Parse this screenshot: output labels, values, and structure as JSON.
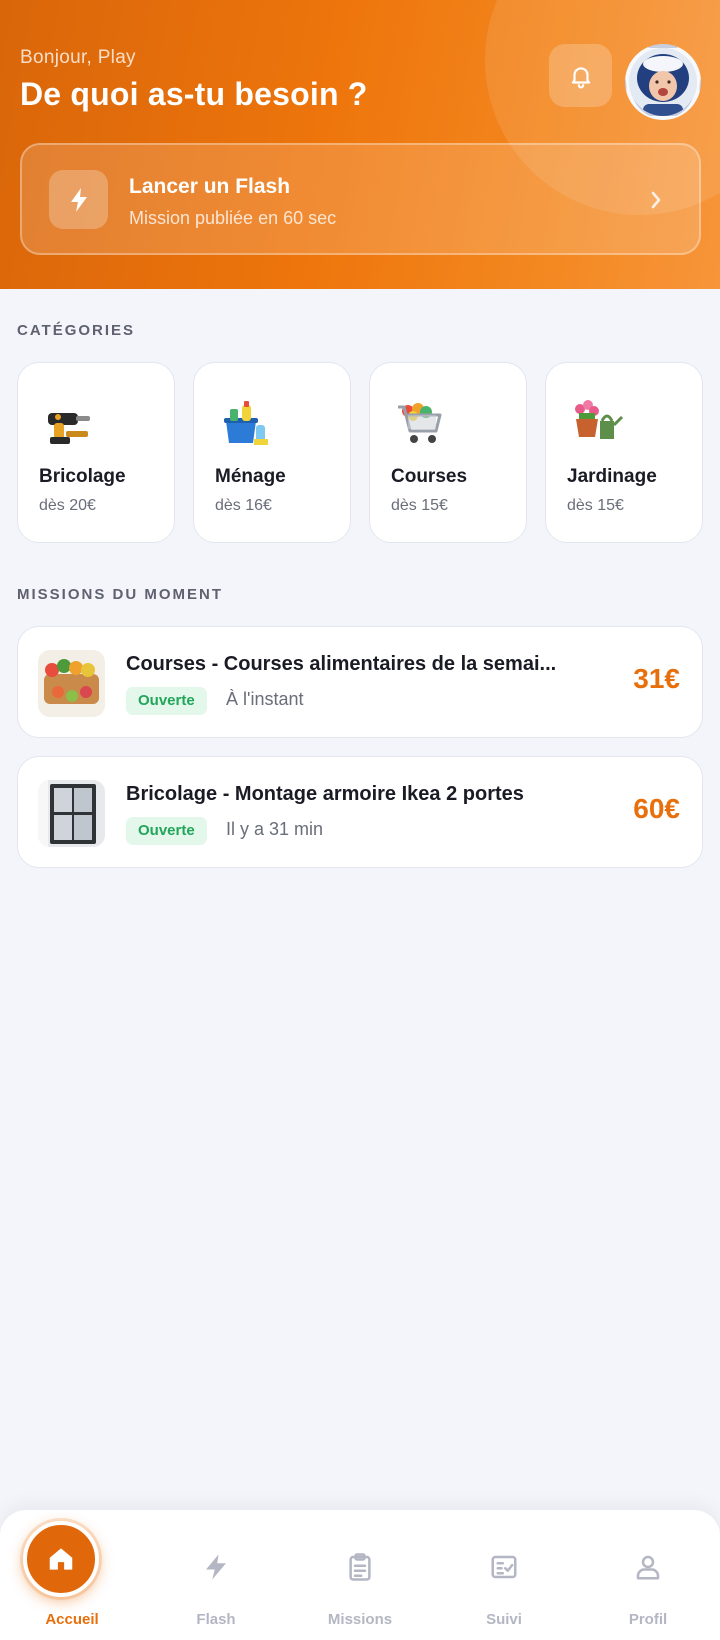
{
  "header": {
    "greeting": "Bonjour, Play",
    "headline": "De quoi as-tu besoin ?",
    "flash": {
      "title": "Lancer un Flash",
      "subtitle": "Mission publiée en 60 sec"
    }
  },
  "categories": {
    "label": "CATÉGORIES",
    "items": [
      {
        "name": "Bricolage",
        "price": "dès 20€",
        "icon": "drill-tools-icon"
      },
      {
        "name": "Ménage",
        "price": "dès 16€",
        "icon": "cleaning-bucket-icon"
      },
      {
        "name": "Courses",
        "price": "dès 15€",
        "icon": "shopping-cart-icon"
      },
      {
        "name": "Jardinage",
        "price": "dès 15€",
        "icon": "flower-pot-watering-can-icon"
      }
    ]
  },
  "missions": {
    "label": "MISSIONS DU MOMENT",
    "items": [
      {
        "title": "Courses - Courses alimentaires de la semai...",
        "status": "Ouverte",
        "time": "À l'instant",
        "amount": "31€"
      },
      {
        "title": "Bricolage - Montage armoire Ikea 2 portes",
        "status": "Ouverte",
        "time": "Il y a 31 min",
        "amount": "60€"
      }
    ]
  },
  "nav": {
    "items": [
      {
        "label": "Accueil",
        "icon": "home-icon",
        "active": true
      },
      {
        "label": "Flash",
        "icon": "bolt-icon"
      },
      {
        "label": "Missions",
        "icon": "clipboard-icon"
      },
      {
        "label": "Suivi",
        "icon": "checklist-icon"
      },
      {
        "label": "Profil",
        "icon": "user-icon"
      }
    ]
  },
  "colors": {
    "accent": "#e8700c",
    "status_open": "#23a55a",
    "background": "#f4f5fa"
  }
}
